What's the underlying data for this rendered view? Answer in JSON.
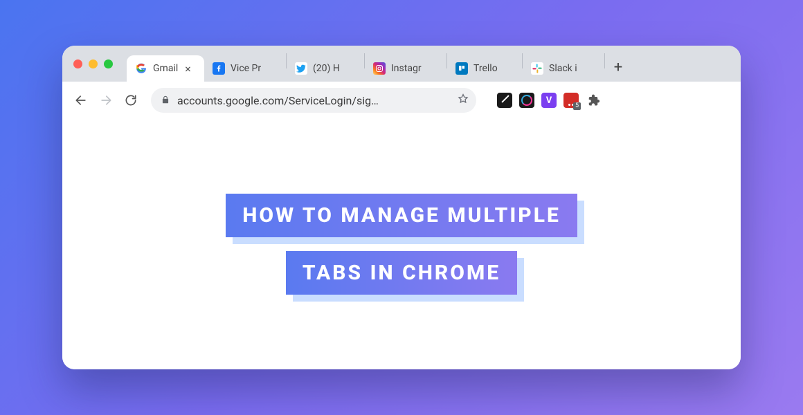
{
  "tabs": [
    {
      "label": "Gmail",
      "icon": "google",
      "active": true
    },
    {
      "label": "Vice Pr",
      "icon": "facebook"
    },
    {
      "label": "(20) H",
      "icon": "twitter"
    },
    {
      "label": "Instagr",
      "icon": "instagram"
    },
    {
      "label": "Trello",
      "icon": "trello"
    },
    {
      "label": "Slack i",
      "icon": "slack"
    }
  ],
  "new_tab_symbol": "+",
  "close_symbol": "×",
  "toolbar": {
    "url": "accounts.google.com/ServiceLogin/sig…"
  },
  "extensions": {
    "vidyard_letter": "V",
    "lastpass_badge": "5"
  },
  "headline": {
    "line1": "HOW TO MANAGE MULTIPLE",
    "line2": "TABS IN CHROME"
  },
  "colors": {
    "bg_gradient_start": "#4a74f0",
    "bg_gradient_end": "#9a7af0",
    "tabstrip": "#dcdfe4",
    "headline_shadow": "#c9ddff"
  }
}
